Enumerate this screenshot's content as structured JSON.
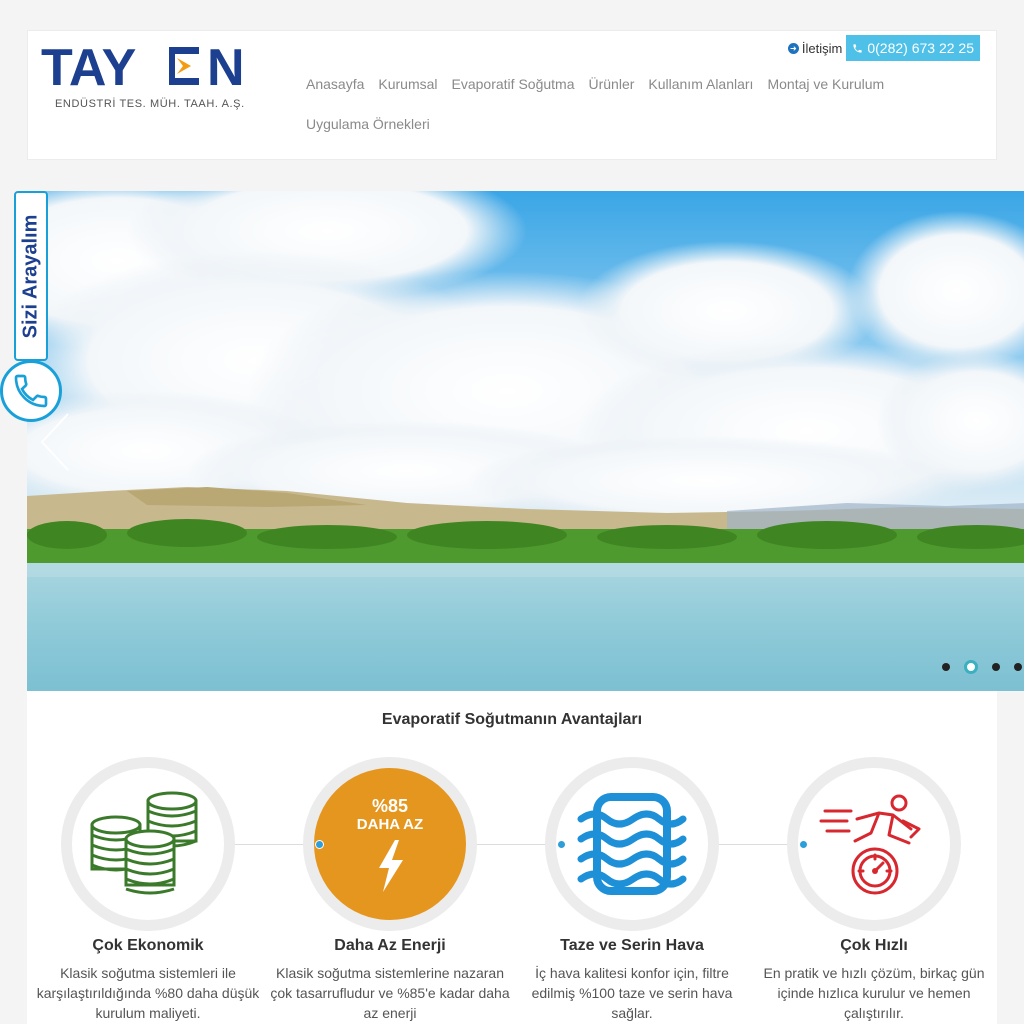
{
  "logo": {
    "brand": "TAYEN",
    "tagline": "ENDÜSTRİ TES. MÜH. TAAH. A.Ş."
  },
  "top_contact": {
    "link_label": "İletişim",
    "phone": "0(282) 673 22 25"
  },
  "nav": [
    {
      "label": "Anasayfa"
    },
    {
      "label": "Kurumsal"
    },
    {
      "label": "Evaporatif Soğutma"
    },
    {
      "label": "Ürünler"
    },
    {
      "label": "Kullanım Alanları"
    },
    {
      "label": "Montaj ve Kurulum"
    },
    {
      "label": "Uygulama Örnekleri"
    }
  ],
  "side_widget": {
    "label": "Sizi Arayalım"
  },
  "slider": {
    "slide_count": 4,
    "active_index": 1
  },
  "advantages": {
    "title": "Evaporatif Soğutmanın Avantajları",
    "items": [
      {
        "title": "Çok Ekonomik",
        "desc": "Klasik soğutma sistemleri ile karşılaştırıldığında %80 daha düşük kurulum maliyeti.",
        "icon": "coins-icon"
      },
      {
        "title": "Daha Az Enerji",
        "desc": "Klasik soğutma sistemlerine nazaran çok tasarrufludur ve %85'e kadar daha az enerji",
        "icon": "lightning-icon",
        "badge_top": "%85",
        "badge_bottom": "DAHA AZ"
      },
      {
        "title": "Taze ve Serin Hava",
        "desc": "İç hava kalitesi konfor için, filtre edilmiş %100 taze ve serin hava sağlar.",
        "icon": "airflow-icon"
      },
      {
        "title": "Çok Hızlı",
        "desc": "En pratik ve hızlı çözüm, birkaç gün içinde hızlıca kurulur ve hemen çalıştırılır.",
        "icon": "speed-runner-icon"
      }
    ]
  },
  "colors": {
    "brand_blue": "#1d3f8f",
    "brand_orange": "#f39c12",
    "accent_cyan": "#4fc0e8",
    "energy_orange": "#e5961f",
    "coin_green": "#3a7a2a",
    "speed_red": "#d8282f",
    "air_blue": "#1e90d8"
  }
}
